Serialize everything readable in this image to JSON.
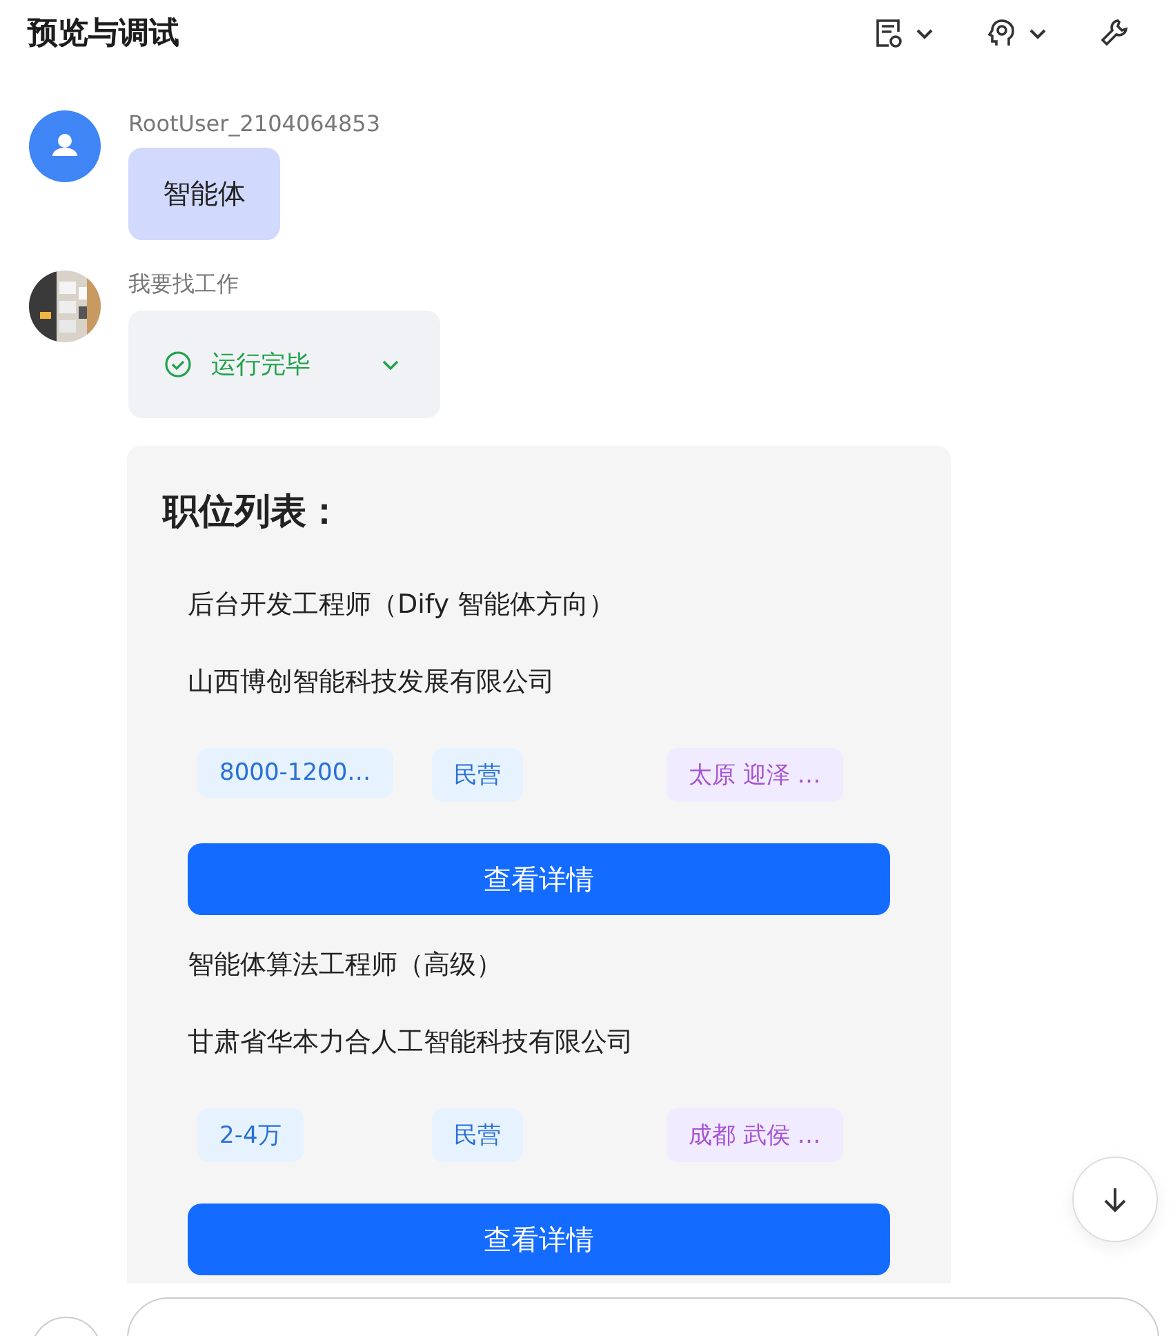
{
  "header": {
    "title": "预览与调试"
  },
  "messages": [
    {
      "kind": "user",
      "name": "RootUser_2104064853",
      "text": "智能体"
    },
    {
      "kind": "bot",
      "name": "我要找工作",
      "status": {
        "label": "运行完毕",
        "expanded": false
      }
    }
  ],
  "job_card": {
    "title": "职位列表：",
    "jobs": [
      {
        "title": "后台开发工程师（Dify 智能体方向）",
        "company": "山西博创智能科技发展有限公司",
        "tags": [
          {
            "text": "8000-1200…",
            "kind": "salary"
          },
          {
            "text": "民营",
            "kind": "type"
          },
          {
            "text": "太原 迎泽 …",
            "kind": "location"
          }
        ],
        "button": "查看详情"
      },
      {
        "title": "智能体算法工程师（高级）",
        "company": "甘肃省华本力合人工智能科技有限公司",
        "tags": [
          {
            "text": "2-4万",
            "kind": "salary"
          },
          {
            "text": "民营",
            "kind": "type"
          },
          {
            "text": "成都 武侯 …",
            "kind": "location"
          }
        ],
        "button": "查看详情"
      }
    ]
  }
}
